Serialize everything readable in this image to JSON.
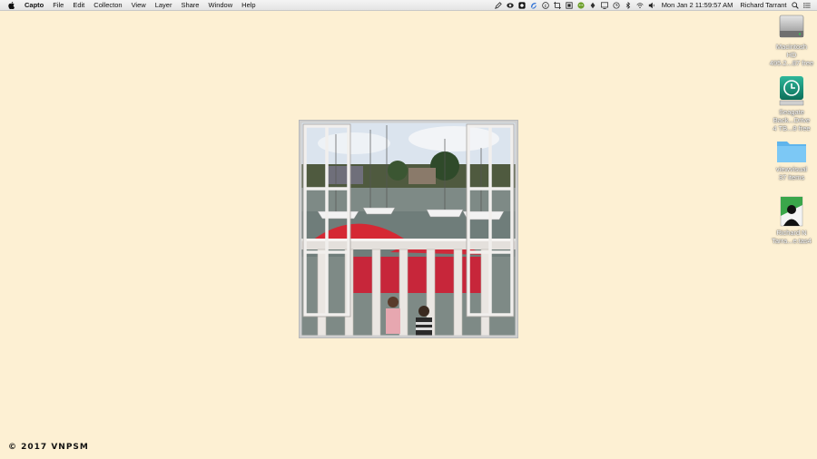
{
  "menubar": {
    "apple_icon": "apple-icon",
    "app_name": "Capto",
    "menus": [
      "File",
      "Edit",
      "Collecton",
      "View",
      "Layer",
      "Share",
      "Window",
      "Help"
    ],
    "status_icons": [
      "pen-icon",
      "cloud-icon",
      "capture-icon",
      "sync-icon",
      "copyright-icon",
      "crop-icon",
      "box-icon",
      "android-icon",
      "weather-icon",
      "display-icon",
      "time-machine-icon",
      "bluetooth-icon",
      "wifi-icon",
      "volume-icon"
    ],
    "clock": "Mon Jan 2  11:59:57 AM",
    "user": "Richard Tarrant",
    "search_icon": "search-icon",
    "list_icon": "notification-list-icon"
  },
  "desktop_icons": [
    {
      "name": "Macintosh HD",
      "line1": "Macintosh",
      "line2": "HD",
      "sub": "495.2...87 free",
      "icon": "hard-drive-icon"
    },
    {
      "name": "Seagate Backup Drive",
      "line1": "Seagate",
      "line2": "Back...Drive",
      "sub": "4 TB...8 free",
      "icon": "time-machine-drive-icon"
    },
    {
      "name": "viewvisual folder",
      "line1": "viewvisual",
      "line2": "",
      "sub": "37 items",
      "icon": "folder-icon"
    },
    {
      "name": "Richard N Tarrant file",
      "line1": "Richard N",
      "line2": "Tarra...e.tas4",
      "sub": "",
      "icon": "person-file-icon"
    }
  ],
  "picture": {
    "subject": "marina-through-open-window"
  },
  "copyright": "© 2017 VNPSM"
}
